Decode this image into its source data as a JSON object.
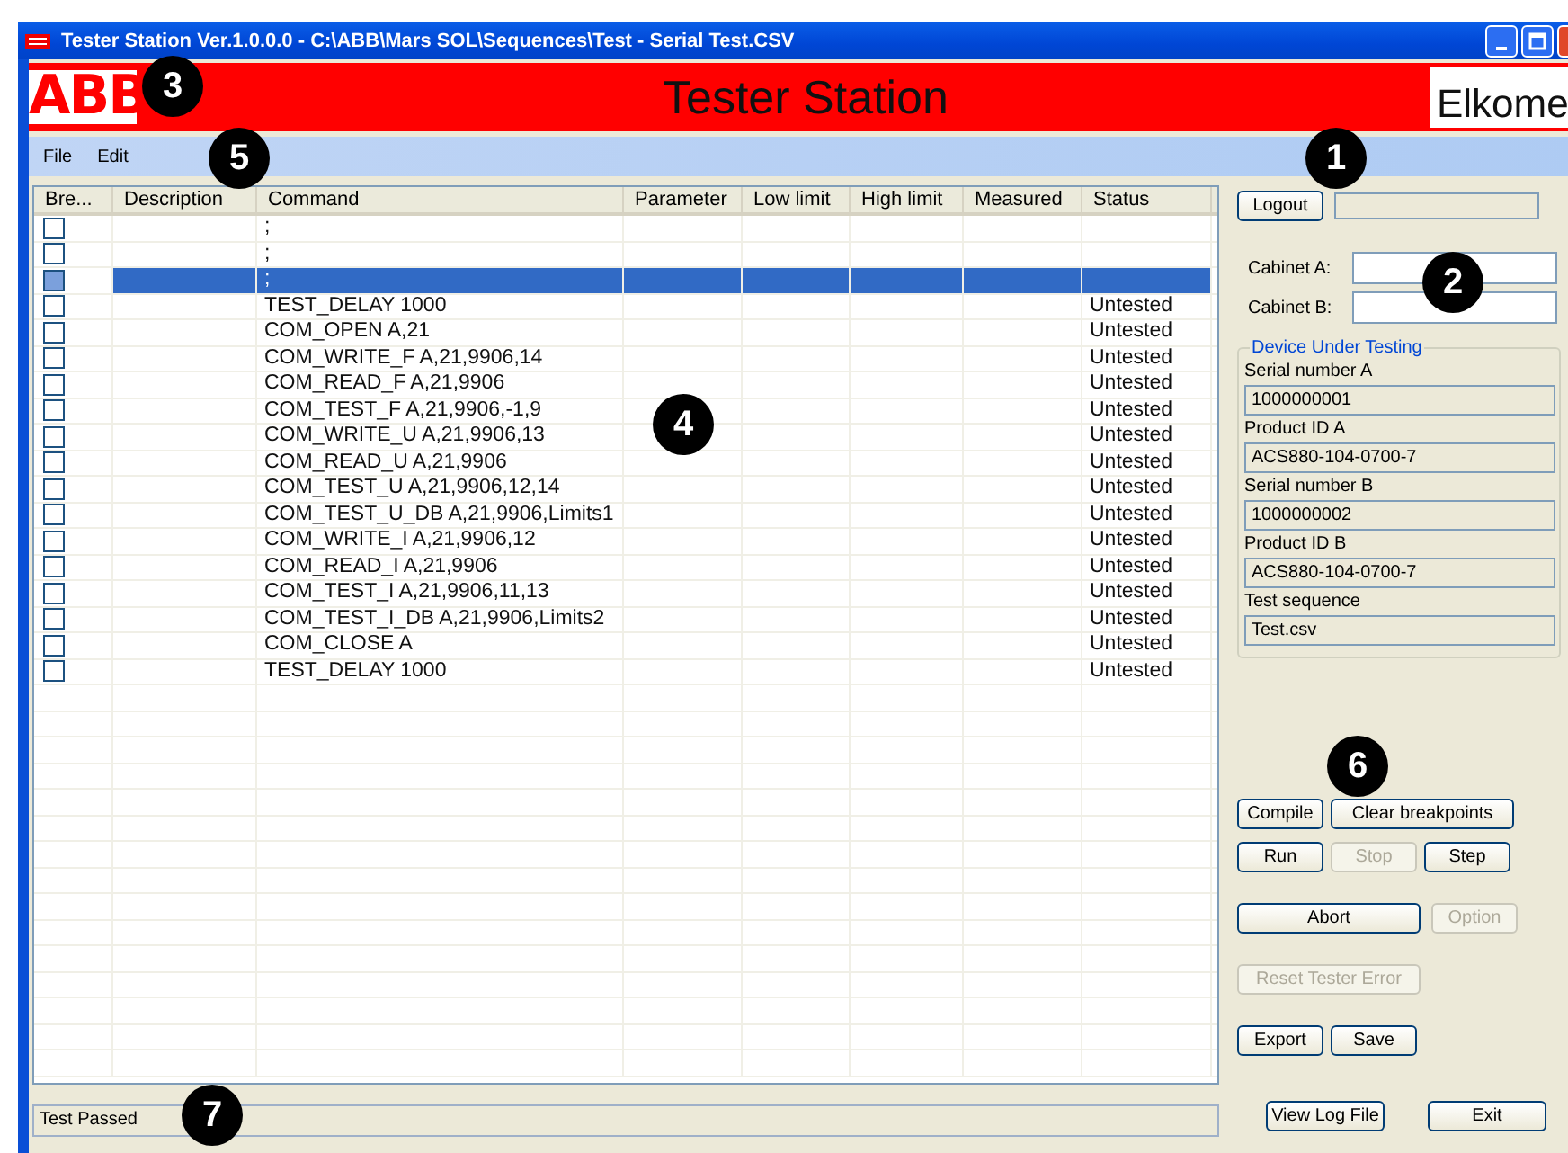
{
  "window": {
    "title": "Tester Station Ver.1.0.0.0 - C:\\ABB\\Mars SOL\\Sequences\\Test - Serial Test.CSV"
  },
  "banner": {
    "logo_left": "ABB",
    "title": "Tester Station",
    "logo_right": "Elkome"
  },
  "menu": [
    "File",
    "Edit"
  ],
  "table": {
    "columns": [
      "Bre...",
      "Description",
      "Command",
      "Parameter",
      "Low limit",
      "High limit",
      "Measured",
      "Status"
    ],
    "rows": [
      {
        "breakpoint": false,
        "selected": false,
        "command": ";"
      },
      {
        "breakpoint": false,
        "selected": false,
        "command": ";"
      },
      {
        "breakpoint": false,
        "selected": true,
        "command": ";"
      },
      {
        "breakpoint": false,
        "selected": false,
        "command": "TEST_DELAY 1000",
        "status": "Untested"
      },
      {
        "breakpoint": false,
        "selected": false,
        "command": "COM_OPEN A,21",
        "status": "Untested"
      },
      {
        "breakpoint": false,
        "selected": false,
        "command": "COM_WRITE_F A,21,9906,14",
        "status": "Untested"
      },
      {
        "breakpoint": false,
        "selected": false,
        "command": "COM_READ_F A,21,9906",
        "status": "Untested"
      },
      {
        "breakpoint": false,
        "selected": false,
        "command": "COM_TEST_F A,21,9906,-1,9",
        "status": "Untested"
      },
      {
        "breakpoint": false,
        "selected": false,
        "command": "COM_WRITE_U A,21,9906,13",
        "status": "Untested"
      },
      {
        "breakpoint": false,
        "selected": false,
        "command": "COM_READ_U A,21,9906",
        "status": "Untested"
      },
      {
        "breakpoint": false,
        "selected": false,
        "command": "COM_TEST_U A,21,9906,12,14",
        "status": "Untested"
      },
      {
        "breakpoint": false,
        "selected": false,
        "command": "COM_TEST_U_DB A,21,9906,Limits1",
        "status": "Untested"
      },
      {
        "breakpoint": false,
        "selected": false,
        "command": "COM_WRITE_I A,21,9906,12",
        "status": "Untested"
      },
      {
        "breakpoint": false,
        "selected": false,
        "command": "COM_READ_I A,21,9906",
        "status": "Untested"
      },
      {
        "breakpoint": false,
        "selected": false,
        "command": "COM_TEST_I A,21,9906,11,13",
        "status": "Untested"
      },
      {
        "breakpoint": false,
        "selected": false,
        "command": "COM_TEST_I_DB A,21,9906,Limits2",
        "status": "Untested"
      },
      {
        "breakpoint": false,
        "selected": false,
        "command": "COM_CLOSE A",
        "status": "Untested"
      },
      {
        "breakpoint": false,
        "selected": false,
        "command": "TEST_DELAY 1000",
        "status": "Untested"
      }
    ]
  },
  "status_bar": "Test Passed",
  "logout_button": {
    "label": "Logout"
  },
  "cabinets": [
    {
      "label": "Cabinet A:"
    },
    {
      "label": "Cabinet B:"
    }
  ],
  "device_group": {
    "title": "Device Under Testing",
    "fields": [
      {
        "label": "Serial number A",
        "value": "1000000001"
      },
      {
        "label": "Product ID A",
        "value": "ACS880-104-0700-7"
      },
      {
        "label": "Serial number B",
        "value": "1000000002"
      },
      {
        "label": "Product ID B",
        "value": "ACS880-104-0700-7"
      },
      {
        "label": "Test sequence",
        "value": "Test.csv"
      }
    ]
  },
  "button_rows": [
    [
      {
        "label": "Compile",
        "kind": "small",
        "disabled": false
      },
      {
        "label": "Clear breakpoints",
        "kind": "wide",
        "disabled": false
      }
    ],
    [
      {
        "label": "Run",
        "kind": "small",
        "disabled": false
      },
      {
        "label": "Stop",
        "kind": "small",
        "disabled": true
      },
      {
        "label": "Step",
        "kind": "small",
        "disabled": false
      }
    ],
    [
      {
        "label": "Abort",
        "kind": "wide",
        "disabled": false
      },
      {
        "label": "Option",
        "kind": "small",
        "disabled": true
      }
    ],
    [
      {
        "label": "Reset Tester Error",
        "kind": "wide",
        "disabled": true
      }
    ],
    [
      {
        "label": "Export",
        "kind": "small",
        "disabled": false
      },
      {
        "label": "Save",
        "kind": "small",
        "disabled": false
      }
    ]
  ],
  "footer_buttons": [
    "View Log File",
    "Exit"
  ],
  "callouts": [
    "1",
    "2",
    "3",
    "4",
    "5",
    "6",
    "7"
  ]
}
